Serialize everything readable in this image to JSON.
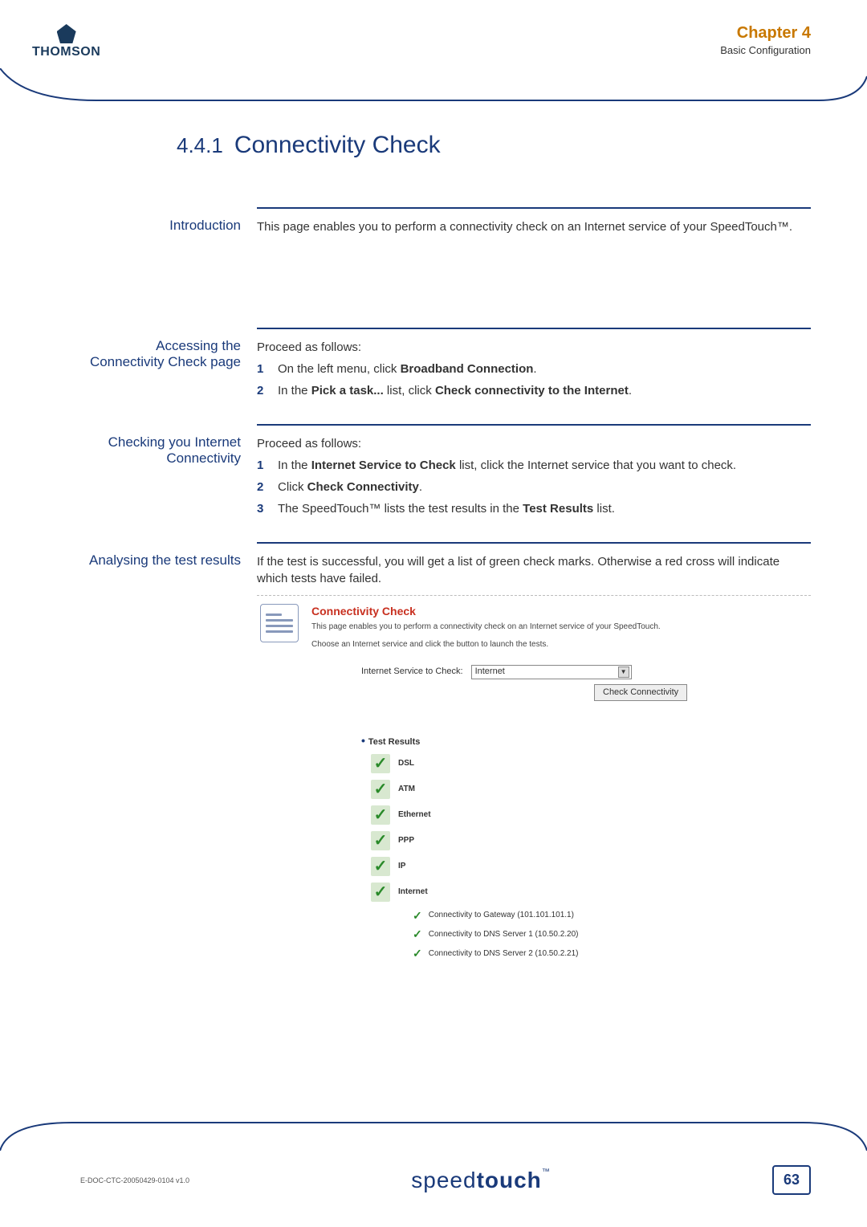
{
  "header": {
    "logo_text": "THOMSON",
    "chapter": "Chapter 4",
    "chapter_sub": "Basic Configuration"
  },
  "title": {
    "num": "4.4.1",
    "heading": "Connectivity Check"
  },
  "intro": {
    "label": "Introduction",
    "text": "This page enables you to perform a connectivity check on an Internet service of your SpeedTouch™."
  },
  "accessing": {
    "label": "Accessing the Connectivity Check page",
    "lead": "Proceed as follows:",
    "items": [
      {
        "n": "1",
        "before": "On the left menu, click ",
        "bold": "Broadband Connection",
        "after": "."
      },
      {
        "n": "2",
        "before": "In the ",
        "bold": "Pick a task...",
        "mid": " list, click ",
        "bold2": "Check connectivity to the Internet",
        "after": "."
      }
    ]
  },
  "checking": {
    "label": "Checking you Internet Connectivity",
    "lead": "Proceed as follows:",
    "items": [
      {
        "n": "1",
        "before": "In the ",
        "bold": "Internet Service to Check",
        "after": " list, click the Internet service that you want to check."
      },
      {
        "n": "2",
        "before": "Click ",
        "bold": "Check Connectivity",
        "after": "."
      },
      {
        "n": "3",
        "before": "The SpeedTouch™ lists the test results in the ",
        "bold": "Test Results",
        "after": " list."
      }
    ]
  },
  "analysing": {
    "label": "Analysing the test results",
    "text": "If the test is successful, you will get a list of green check marks. Otherwise a red cross will indicate which tests have failed."
  },
  "screenshot": {
    "title": "Connectivity Check",
    "desc1": "This page enables you to perform a connectivity check on an Internet service of your SpeedTouch.",
    "desc2": "Choose an Internet service and click the button to launch the tests.",
    "form_label": "Internet Service to Check:",
    "select_value": "Internet",
    "button_label": "Check Connectivity",
    "results_header": "Test Results",
    "results": [
      "DSL",
      "ATM",
      "Ethernet",
      "PPP",
      "IP",
      "Internet"
    ],
    "sub_results": [
      "Connectivity to Gateway (101.101.101.1)",
      "Connectivity to DNS Server 1 (10.50.2.20)",
      "Connectivity to DNS Server 2 (10.50.2.21)"
    ]
  },
  "footer": {
    "doc_id": "E-DOC-CTC-20050429-0104 v1.0",
    "brand_thin": "speed",
    "brand_bold": "touch",
    "brand_tm": "™",
    "page": "63"
  }
}
